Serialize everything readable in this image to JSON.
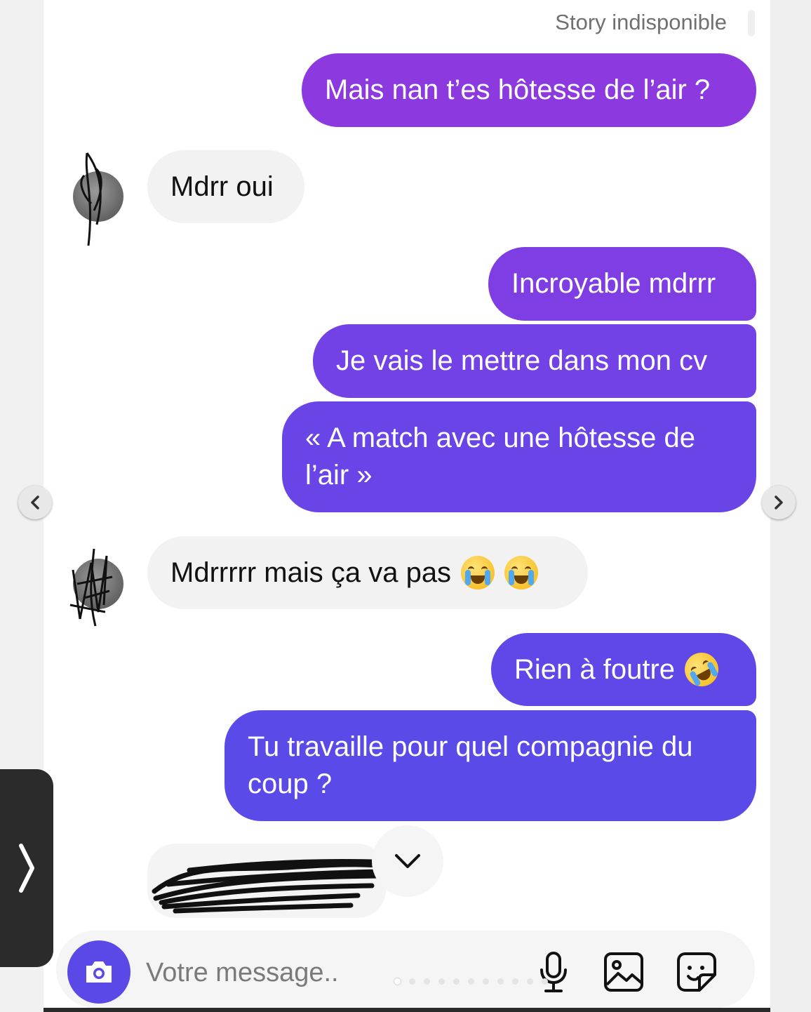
{
  "story": {
    "label": "Story indisponible"
  },
  "messages": [
    {
      "side": "sent",
      "text": "Mais nan t’es hôtesse de l’air ?"
    },
    {
      "side": "received",
      "text": "Mdrr oui"
    },
    {
      "side": "sent",
      "text": "Incroyable mdrrr"
    },
    {
      "side": "sent",
      "text": "Je vais le mettre dans mon cv"
    },
    {
      "side": "sent",
      "text": "« A match avec une hôtesse de l’air »"
    },
    {
      "side": "received",
      "text": "Mdrrrrr mais ça va pas",
      "emoji": [
        "loudly-crying-face",
        "loudly-crying-face"
      ]
    },
    {
      "side": "sent",
      "text": "Rien à foutre",
      "emoji": [
        "rolling-on-the-floor-laughing"
      ]
    },
    {
      "side": "sent",
      "text": "Tu travaille pour quel compagnie du coup ?"
    }
  ],
  "composer": {
    "placeholder": "Votre message..",
    "icons": [
      "camera-icon",
      "microphone-icon",
      "image-icon",
      "sticker-icon"
    ]
  },
  "colors": {
    "sent_gradient_top": "#8b3be0",
    "sent_gradient_bottom": "#5a4be8",
    "received_bubble": "#f2f2f2",
    "camera_button": "#5a49e6"
  }
}
